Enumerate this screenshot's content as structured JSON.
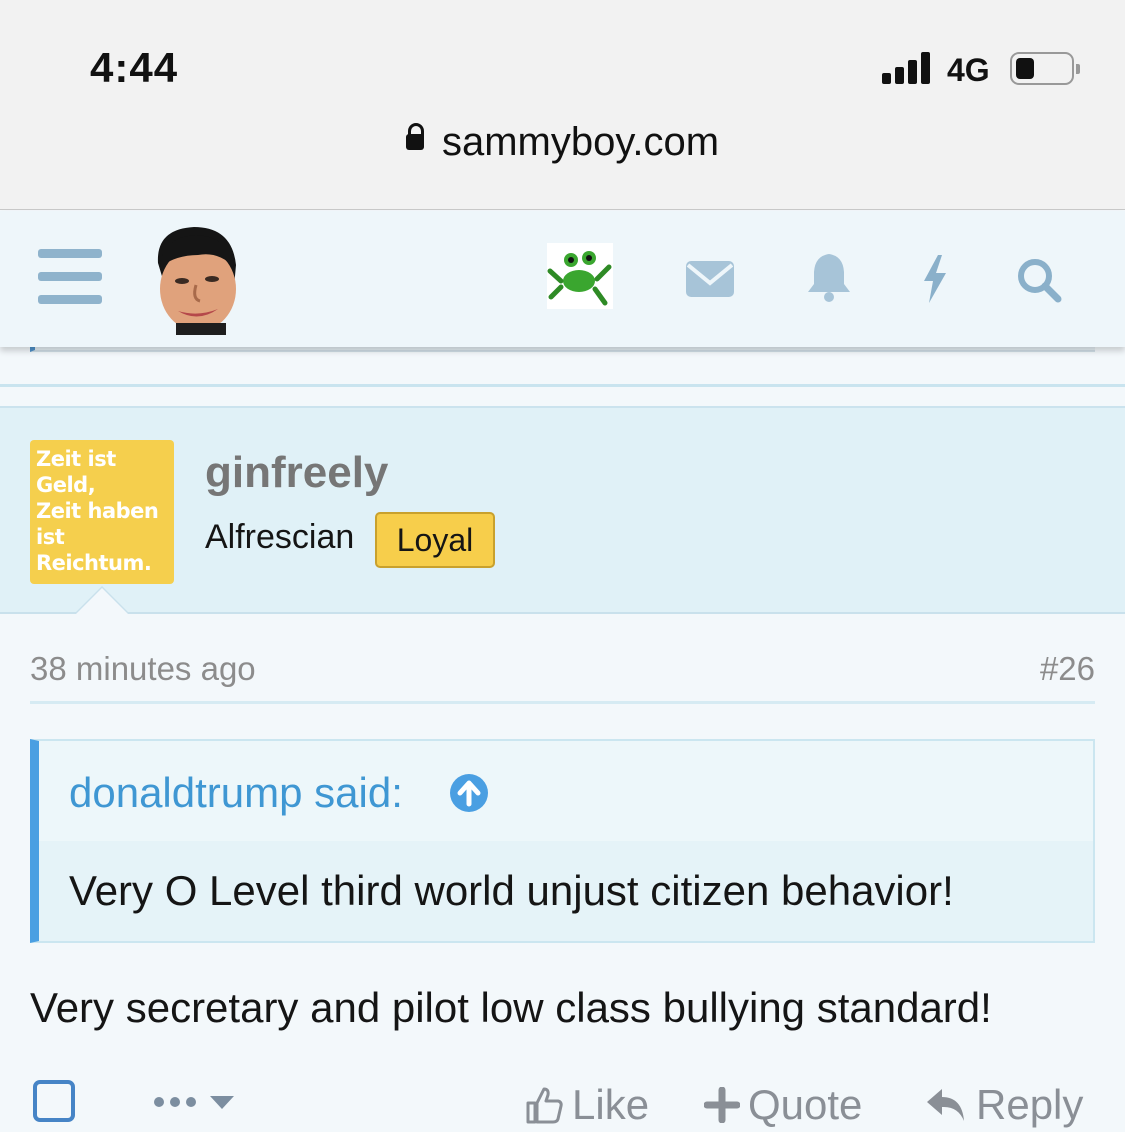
{
  "status": {
    "time": "4:44",
    "network": "4G"
  },
  "browser": {
    "url": "sammyboy.com"
  },
  "header": {
    "icons": [
      "menu-icon",
      "user-avatar",
      "frog-logo",
      "mail-icon",
      "bell-icon",
      "bolt-icon",
      "search-icon"
    ]
  },
  "post": {
    "author": {
      "avatar_text": [
        "Zeit ist",
        "Geld,",
        "Zeit haben",
        "ist",
        "Reichtum."
      ],
      "name": "ginfreely",
      "title": "Alfrescian",
      "badge": "Loyal"
    },
    "time": "38 minutes ago",
    "number": "#26",
    "quote": {
      "author": "donaldtrump said:",
      "text": "Very O Level third world unjust citizen behavior!"
    },
    "body": "Very secretary and pilot low class bullying standard!",
    "actions": {
      "like": "Like",
      "quote": "Quote",
      "reply": "Reply"
    }
  },
  "colors": {
    "accent": "#4a9fe2",
    "badge": "#f7ce4b",
    "header_bg": "#eef6fa",
    "user_block_bg": "#e0f1f7"
  }
}
